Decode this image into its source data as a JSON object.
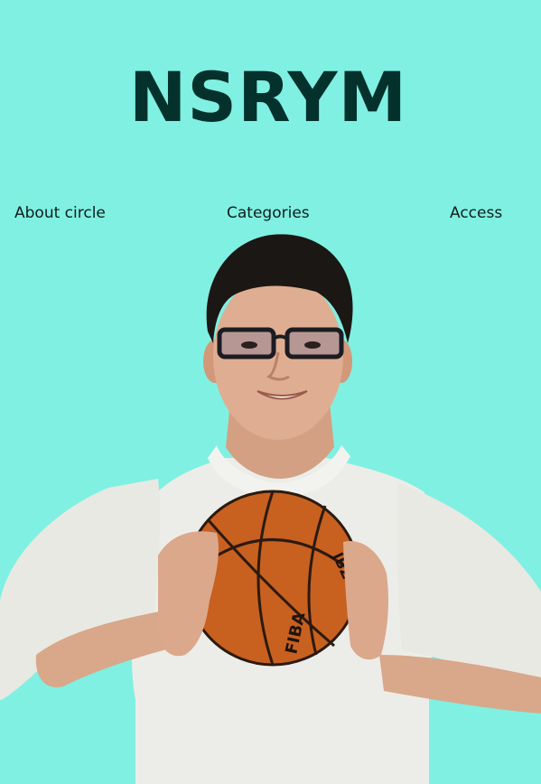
{
  "site": {
    "title": "NSRYM",
    "background_color": "#80F0E2",
    "title_color": "#04312C"
  },
  "nav": {
    "items": [
      {
        "label": "About circle"
      },
      {
        "label": "Categories"
      },
      {
        "label": "Access"
      }
    ]
  },
  "hero": {
    "image": "smiling young man with glasses in white long-sleeve shirt holding a basketball",
    "ball_print": "FIBA",
    "ball_brand": "JBZ",
    "ball_color": "#C8601F",
    "shirt_color": "#ECEDE8"
  }
}
